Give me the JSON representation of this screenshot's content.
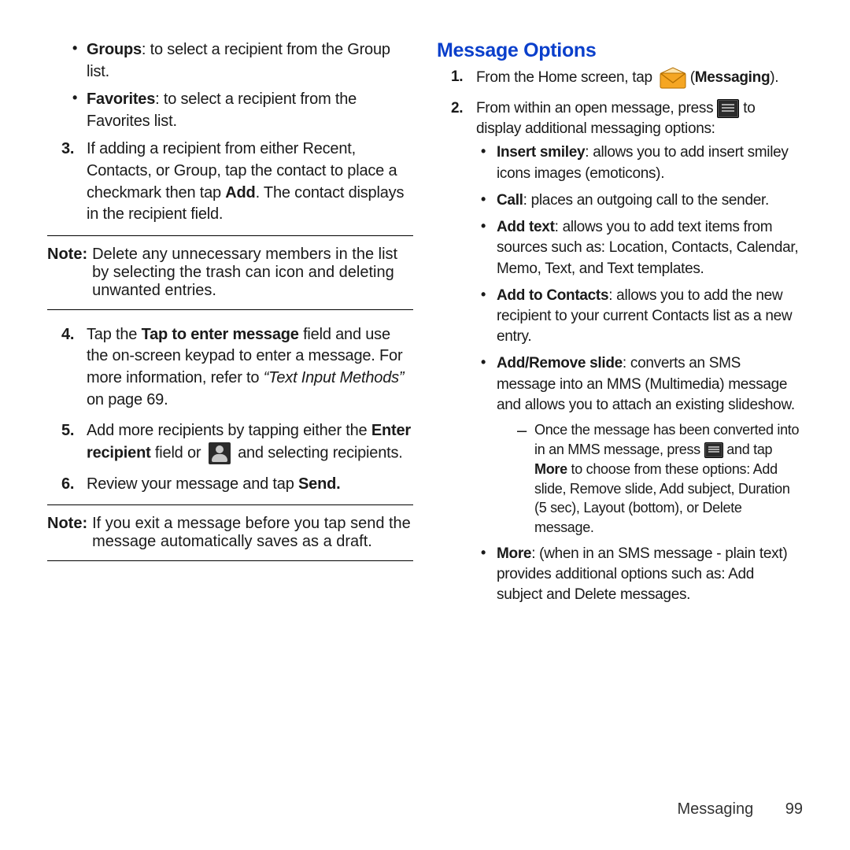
{
  "footer": {
    "section": "Messaging",
    "page": "99"
  },
  "left": {
    "groups": {
      "label": "Groups",
      "desc": ": to select a recipient from the Group list."
    },
    "favorites": {
      "label": "Favorites",
      "desc": ": to select a recipient from the Favorites list."
    },
    "step3": {
      "n": "3.",
      "pre": "If adding a recipient from either Recent, Contacts, or Group, tap the contact to place a checkmark then tap ",
      "bold": "Add",
      "post": ". The contact displays in the recipient field."
    },
    "note1": {
      "label": "Note:",
      "text": "Delete any unnecessary members in the list by selecting the trash can icon and deleting unwanted entries."
    },
    "step4": {
      "n": "4.",
      "pre": "Tap the ",
      "bold": "Tap to enter message",
      "mid": " field and use the on-screen keypad to enter a message. For more information, refer to ",
      "ital": "“Text Input Methods”",
      "post": "  on page 69."
    },
    "step5": {
      "n": "5.",
      "pre": "Add more recipients by tapping either the ",
      "bold": "Enter recipient",
      "mid": " field or ",
      "post": " and selecting recipients."
    },
    "step6": {
      "n": "6.",
      "pre": "Review your message and tap ",
      "bold": "Send."
    },
    "note2": {
      "label": "Note:",
      "text": "If you exit a message before you tap send the message automatically saves as a draft."
    }
  },
  "right": {
    "heading": "Message Options",
    "step1": {
      "n": "1.",
      "pre": "From the Home screen, tap ",
      "post": " (",
      "bold": "Messaging",
      "close": ")."
    },
    "step2": {
      "n": "2.",
      "pre": "From within an open message, press ",
      "post": " to display additional messaging options:"
    },
    "opts": {
      "smiley": {
        "label": "Insert smiley",
        "desc": ": allows you to add insert smiley icons images (emoticons)."
      },
      "call": {
        "label": "Call",
        "desc": ": places an outgoing call to the sender."
      },
      "addtext": {
        "label": "Add text",
        "desc": ": allows you to add text items from sources such as: Location, Contacts, Calendar, Memo, Text, and Text templates."
      },
      "addcontacts": {
        "label": "Add to Contacts",
        "desc": ": allows you to add the new recipient to your current Contacts list as a new entry."
      },
      "addslide": {
        "label": "Add/Remove slide",
        "desc": ": converts an SMS message into an MMS (Multimedia) message and allows you to attach an existing slideshow."
      },
      "addslide_sub": {
        "pre": "Once the message has been converted into in an MMS message, press ",
        "mid": " and tap ",
        "bold": "More",
        "post": " to choose from these options: Add slide, Remove slide, Add subject, Duration (5 sec), Layout (bottom), or Delete message."
      },
      "more": {
        "label": "More",
        "desc": ": (when in an SMS message - plain text) provides additional options such as: Add subject and Delete messages."
      }
    }
  }
}
